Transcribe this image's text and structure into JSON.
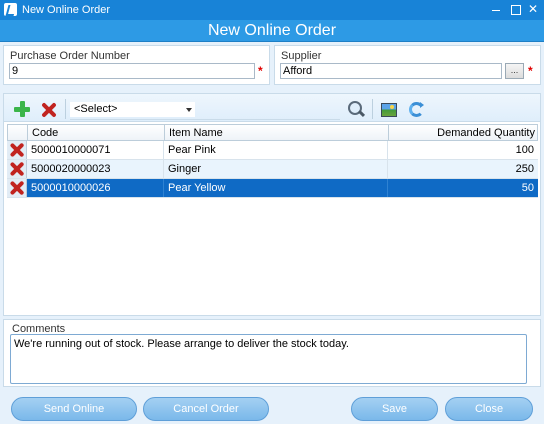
{
  "window": {
    "title": "New Online Order"
  },
  "header": {
    "title": "New Online Order"
  },
  "purchase_order": {
    "label": "Purchase Order Number",
    "value": "9",
    "required_mark": "*"
  },
  "supplier": {
    "label": "Supplier",
    "value": "Afford",
    "browse_label": "...",
    "required_mark": "*"
  },
  "toolbar": {
    "select_value": "<Select>",
    "icons": [
      "add-icon",
      "delete-icon",
      "search-icon",
      "image-icon",
      "refresh-icon"
    ]
  },
  "grid": {
    "columns": [
      "Code",
      "Item Name",
      "Demanded Quantity"
    ],
    "rows": [
      {
        "code": "5000010000071",
        "name": "Pear Pink",
        "qty": "100"
      },
      {
        "code": "5000020000023",
        "name": "Ginger",
        "qty": "250"
      },
      {
        "code": "5000010000026",
        "name": "Pear Yellow",
        "qty": "50"
      }
    ],
    "selected_row": 2
  },
  "comments": {
    "label": "Comments",
    "value": "We're running out of stock. Please arrange to deliver the stock today."
  },
  "buttons": {
    "send_online": "Send Online",
    "cancel_order": "Cancel Order",
    "save": "Save",
    "close": "Close"
  },
  "colors": {
    "titlebar": "#1883d7",
    "header": "#2d9ae5",
    "selection": "#0f6ac5",
    "button": "#7ab8ea",
    "required": "#e00000",
    "delete": "#c1231f",
    "add": "#3bb54a"
  }
}
